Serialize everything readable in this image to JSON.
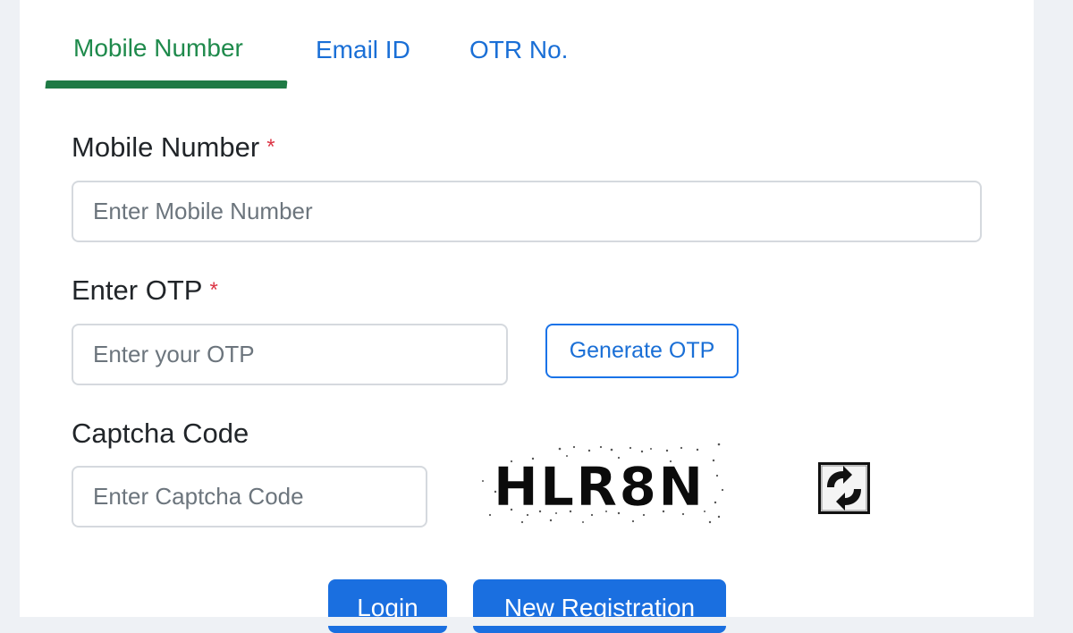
{
  "tabs": {
    "mobile": "Mobile Number",
    "email": "Email ID",
    "otr": "OTR No."
  },
  "form": {
    "mobile_label": "Mobile Number",
    "mobile_placeholder": "Enter Mobile Number",
    "otp_label": "Enter OTP",
    "otp_placeholder": "Enter your OTP",
    "generate_otp_label": "Generate OTP",
    "captcha_label": "Captcha Code",
    "captcha_placeholder": "Enter Captcha Code",
    "captcha_text": "HLR8N",
    "required_marker": "*"
  },
  "actions": {
    "login_label": "Login",
    "register_label": "New Registration"
  },
  "icons": {
    "refresh": "refresh-captcha-icon"
  },
  "colors": {
    "active_tab": "#1f8a4c",
    "tab_link": "#1a6fd6",
    "primary": "#1a6fe0",
    "required": "#dc3545"
  }
}
